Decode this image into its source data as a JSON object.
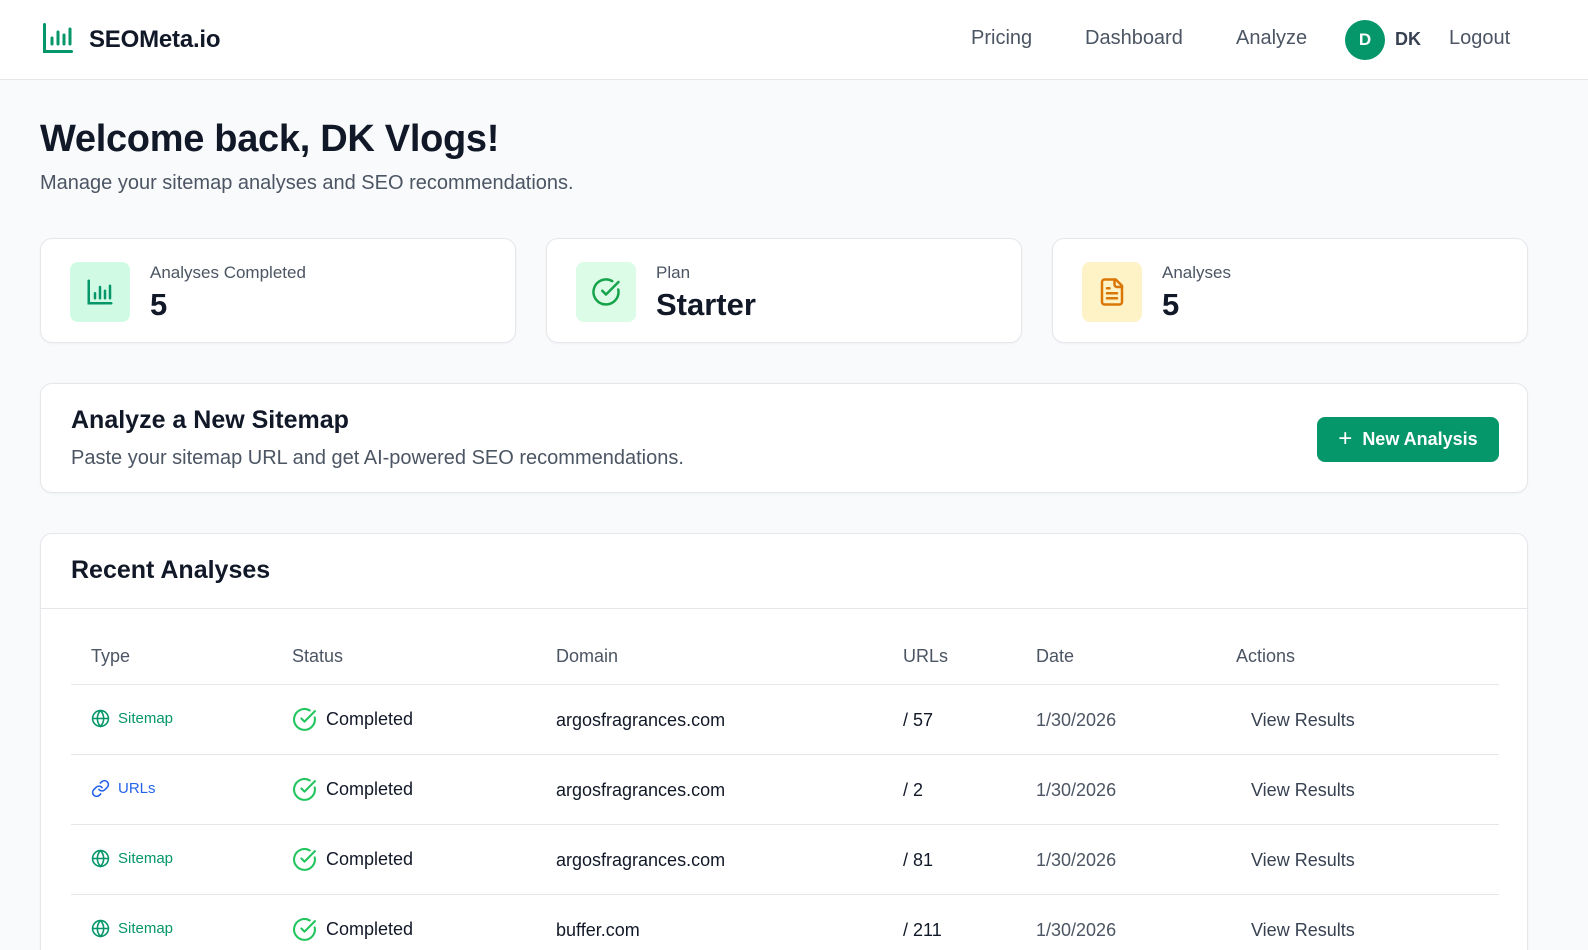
{
  "brand": {
    "name": "SEOMeta.io",
    "icon": "bar-chart-icon",
    "color": "#059669"
  },
  "nav": {
    "links": [
      "Pricing",
      "Dashboard",
      "Analyze"
    ],
    "avatar_letter": "D",
    "user_initials": "DK",
    "logout": "Logout"
  },
  "welcome": {
    "title": "Welcome back, DK Vlogs!",
    "subtitle": "Manage your sitemap analyses and SEO recommendations."
  },
  "stats": [
    {
      "label": "Analyses Completed",
      "value": "5",
      "icon": "bar-chart-icon",
      "bg": "#d1fae5",
      "color": "#059669"
    },
    {
      "label": "Plan",
      "value": "Starter",
      "icon": "check-circle-icon",
      "bg": "#dcfce7",
      "color": "#16a34a"
    },
    {
      "label": "Analyses",
      "value": "5",
      "icon": "document-icon",
      "bg": "#fef3c7",
      "color": "#d97706"
    }
  ],
  "analyze": {
    "title": "Analyze a New Sitemap",
    "subtitle": "Paste your sitemap URL and get AI-powered SEO recommendations.",
    "button_label": "New Analysis"
  },
  "recent": {
    "title": "Recent Analyses",
    "columns": [
      "Type",
      "Status",
      "Domain",
      "URLs",
      "Date",
      "Actions"
    ],
    "rows": [
      {
        "type": "Sitemap",
        "type_icon": "globe-icon",
        "status": "Completed",
        "domain": "argosfragrances.com",
        "urls": "/ 57",
        "date": "1/30/2026",
        "action": "View Results"
      },
      {
        "type": "URLs",
        "type_icon": "link-icon",
        "status": "Completed",
        "domain": "argosfragrances.com",
        "urls": "/ 2",
        "date": "1/30/2026",
        "action": "View Results"
      },
      {
        "type": "Sitemap",
        "type_icon": "globe-icon",
        "status": "Completed",
        "domain": "argosfragrances.com",
        "urls": "/ 81",
        "date": "1/30/2026",
        "action": "View Results"
      },
      {
        "type": "Sitemap",
        "type_icon": "globe-icon",
        "status": "Completed",
        "domain": "buffer.com",
        "urls": "/ 211",
        "date": "1/30/2026",
        "action": "View Results"
      }
    ]
  },
  "colors": {
    "accent": "#059669",
    "sitemap_type": "#059669",
    "urls_type": "#2563eb",
    "status_ok": "#22c55e"
  }
}
